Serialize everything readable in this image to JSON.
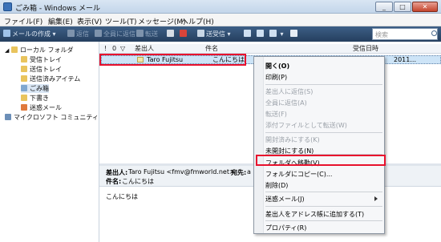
{
  "window": {
    "title": "ごみ箱 - Windows メール"
  },
  "menubar": {
    "items": [
      "ファイル(F)",
      "編集(E)",
      "表示(V)",
      "ツール(T)",
      "メッセージ(M)",
      "ヘルプ(H)"
    ]
  },
  "toolbar": {
    "items": [
      "メールの作成",
      "返信",
      "全員に返信",
      "転送",
      "送受信"
    ],
    "search_placeholder": "検索"
  },
  "folders": [
    {
      "label": "ローカル フォルダ"
    },
    {
      "label": "受信トレイ"
    },
    {
      "label": "送信トレイ"
    },
    {
      "label": "送信済みアイテム"
    },
    {
      "label": "ごみ箱"
    },
    {
      "label": "下書き"
    },
    {
      "label": "迷惑メール"
    },
    {
      "label": "マイクロソフト コミュニティ"
    }
  ],
  "list": {
    "columns": [
      "!",
      "0",
      "▽",
      "差出人",
      "件名",
      "受信日時"
    ],
    "row": {
      "from": "Taro Fujitsu",
      "subject": "こんにちは",
      "date": "2011..."
    }
  },
  "preview": {
    "from_label": "差出人:",
    "from_value": "Taro Fujitsu <fmv@fmworld.net>",
    "to_label": "宛先:",
    "to_value": "a",
    "subject_label": "件名:",
    "subject_value": "こんにちは",
    "body": "こんにちは"
  },
  "context_menu": {
    "items": [
      {
        "label": "開く(O)",
        "enabled": true
      },
      {
        "label": "印刷(P)",
        "enabled": true
      },
      {
        "label": "差出人に返信(S)",
        "enabled": false
      },
      {
        "label": "全員に返信(A)",
        "enabled": false
      },
      {
        "label": "転送(F)",
        "enabled": false
      },
      {
        "label": "添付ファイルとして転送(W)",
        "enabled": false
      },
      {
        "label": "開封済みにする(K)",
        "enabled": false
      },
      {
        "label": "未開封にする(N)",
        "enabled": true
      },
      {
        "label": "フォルダへ移動(V)...",
        "enabled": true
      },
      {
        "label": "フォルダにコピー(C)...",
        "enabled": true
      },
      {
        "label": "削除(D)",
        "enabled": true
      },
      {
        "label": "迷惑メール(J)",
        "enabled": true
      },
      {
        "label": "差出人をアドレス帳に追加する(T)",
        "enabled": true
      },
      {
        "label": "プロパティ(R)",
        "enabled": true
      }
    ]
  },
  "colors": {
    "highlight": "#e8112d",
    "selection": "#cde4f7",
    "toolbar": "#2f4e72"
  }
}
